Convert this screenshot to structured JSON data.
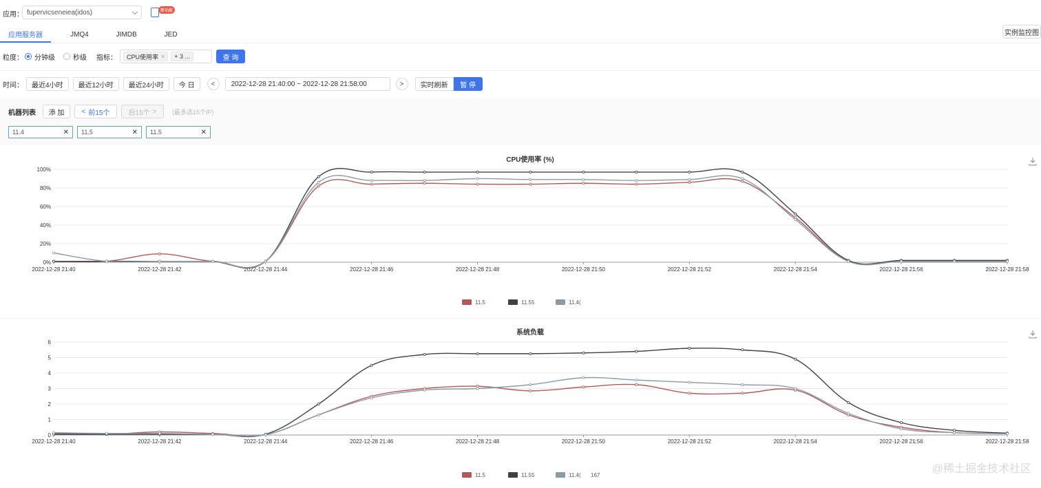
{
  "header": {
    "app_label": "应用：",
    "app_value": "fupervicseneiea(idos)",
    "new_badge": "新功能"
  },
  "tabs": [
    {
      "label": "应用服务器",
      "active": true
    },
    {
      "label": "JMQ4",
      "active": false
    },
    {
      "label": "JIMDB",
      "active": false
    },
    {
      "label": "JED",
      "active": false
    }
  ],
  "instance_monitor_label": "实例监控图",
  "granularity": {
    "label": "粒度：",
    "options": [
      "分钟级",
      "秒级"
    ],
    "selected": 0
  },
  "metric": {
    "label": "指标：",
    "chip": "CPU使用率",
    "more": "+ 3 ...",
    "query_label": "查 询"
  },
  "time": {
    "label": "时间：",
    "quick": [
      "最近4小时",
      "最近12小时",
      "最近24小时",
      "今 日"
    ],
    "prev": "<",
    "next": ">",
    "range": "2022-12-28 21:40:00 ~ 2022-12-28 21:58:00",
    "refresh_label": "实时刷新",
    "pause_label": "暂 停"
  },
  "machines": {
    "label": "机器列表",
    "add_label": "添 加",
    "prev_label": "前15个",
    "next_label": "后15个",
    "hint": "(最多选15个IP)",
    "ips": [
      "11.4",
      "11.5",
      "11.5"
    ]
  },
  "colors": {
    "primary": "#3f75e8",
    "series_red": "#b05a5a",
    "series_dark": "#3d4247",
    "series_gray": "#8c9ba3"
  },
  "charts": [
    {
      "title": "CPU使用率 (%)",
      "legend_extra": "",
      "chart_data": {
        "type": "line",
        "title": "CPU使用率 (%)",
        "x": [
          "2022-12-28 21:40",
          "2022-12-28 21:41",
          "2022-12-28 21:42",
          "2022-12-28 21:43",
          "2022-12-28 21:44",
          "2022-12-28 21:45",
          "2022-12-28 21:46",
          "2022-12-28 21:47",
          "2022-12-28 21:48",
          "2022-12-28 21:49",
          "2022-12-28 21:50",
          "2022-12-28 21:51",
          "2022-12-28 21:52",
          "2022-12-28 21:53",
          "2022-12-28 21:54",
          "2022-12-28 21:55",
          "2022-12-28 21:56",
          "2022-12-28 21:57",
          "2022-12-28 21:58"
        ],
        "x_ticks": [
          "2022-12-28 21:40",
          "2022-12-28 21:42",
          "2022-12-28 21:44",
          "2022-12-28 21:46",
          "2022-12-28 21:48",
          "2022-12-28 21:50",
          "2022-12-28 21:52",
          "2022-12-28 21:54",
          "2022-12-28 21:56",
          "2022-12-28 21:58"
        ],
        "y_ticks": [
          "0%",
          "20%",
          "40%",
          "60%",
          "80%",
          "100%"
        ],
        "ylim": [
          0,
          100
        ],
        "legend_position": "bottom-center",
        "grid": true,
        "series": [
          {
            "name": "11.5",
            "color": "#b05a5a",
            "values": [
              1,
              1,
              9,
              1,
              1,
              82,
              84,
              85,
              84,
              84,
              85,
              84,
              86,
              87,
              48,
              1,
              1,
              1,
              1
            ]
          },
          {
            "name": "11.55",
            "color": "#3d4247",
            "values": [
              1,
              1,
              1,
              1,
              1,
              92,
              97,
              97,
              97,
              97,
              97,
              97,
              97,
              97,
              52,
              2,
              2,
              2,
              2
            ]
          },
          {
            "name": "11.4(",
            "color": "#8c9ba3",
            "values": [
              10,
              1,
              1,
              1,
              1,
              86,
              88,
              88,
              90,
              89,
              89,
              88,
              89,
              90,
              46,
              1,
              1,
              1,
              1
            ]
          }
        ]
      }
    },
    {
      "title": "系统负载",
      "legend_extra": "167",
      "chart_data": {
        "type": "line",
        "title": "系统负载",
        "x": [
          "2022-12-28 21:40",
          "2022-12-28 21:41",
          "2022-12-28 21:42",
          "2022-12-28 21:43",
          "2022-12-28 21:44",
          "2022-12-28 21:45",
          "2022-12-28 21:46",
          "2022-12-28 21:47",
          "2022-12-28 21:48",
          "2022-12-28 21:49",
          "2022-12-28 21:50",
          "2022-12-28 21:51",
          "2022-12-28 21:52",
          "2022-12-28 21:53",
          "2022-12-28 21:54",
          "2022-12-28 21:55",
          "2022-12-28 21:56",
          "2022-12-28 21:57",
          "2022-12-28 21:58"
        ],
        "x_ticks": [
          "2022-12-28 21:40",
          "2022-12-28 21:42",
          "2022-12-28 21:44",
          "2022-12-28 21:46",
          "2022-12-28 21:48",
          "2022-12-28 21:50",
          "2022-12-28 21:52",
          "2022-12-28 21:54",
          "2022-12-28 21:56",
          "2022-12-28 21:58"
        ],
        "y_ticks": [
          "0",
          "1",
          "2",
          "3",
          "4",
          "5",
          "6"
        ],
        "ylim": [
          0,
          6
        ],
        "legend_position": "bottom-center",
        "grid": true,
        "series": [
          {
            "name": "11.5",
            "color": "#b05a5a",
            "values": [
              0.1,
              0.05,
              0.2,
              0.1,
              0.02,
              1.3,
              2.5,
              3.0,
              3.15,
              2.85,
              3.1,
              3.25,
              2.7,
              2.7,
              2.9,
              1.3,
              0.5,
              0.15,
              0.1
            ]
          },
          {
            "name": "11.55",
            "color": "#3d4247",
            "values": [
              0.05,
              0.05,
              0.05,
              0.05,
              0.05,
              2.0,
              4.5,
              5.2,
              5.25,
              5.25,
              5.3,
              5.4,
              5.6,
              5.5,
              4.9,
              2.1,
              0.8,
              0.3,
              0.12
            ]
          },
          {
            "name": "11.4(",
            "color": "#8c9ba3",
            "values": [
              0.15,
              0.1,
              0.1,
              0.05,
              0.02,
              1.3,
              2.4,
              2.9,
              3.0,
              3.25,
              3.7,
              3.55,
              3.4,
              3.25,
              3.0,
              1.4,
              0.4,
              0.15,
              0.08
            ]
          }
        ]
      }
    }
  ],
  "watermark": "@稀土掘金技术社区"
}
